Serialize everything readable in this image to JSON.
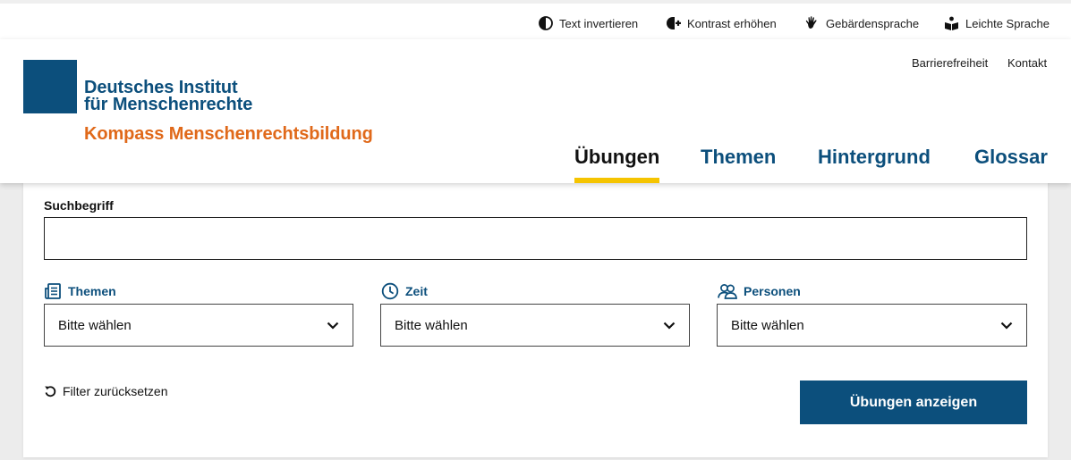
{
  "accessibility_bar": {
    "invert_text": "Text invertieren",
    "contrast": "Kontrast erhöhen",
    "sign_language": "Gebärdensprache",
    "easy_language": "Leichte Sprache"
  },
  "header": {
    "org_line1": "Deutsches Institut",
    "org_line2": "für Menschenrechte",
    "subtitle": "Kompass Menschenrechtsbildung",
    "meta_links": [
      "Barrierefreiheit",
      "Kontakt"
    ],
    "nav": [
      {
        "label": "Übungen",
        "active": true
      },
      {
        "label": "Themen",
        "active": false
      },
      {
        "label": "Hintergrund",
        "active": false
      },
      {
        "label": "Glossar",
        "active": false
      }
    ]
  },
  "search": {
    "label": "Suchbegriff",
    "value": "",
    "placeholder": ""
  },
  "filters": [
    {
      "label": "Themen",
      "icon": "document-list-icon",
      "selected": "Bitte wählen"
    },
    {
      "label": "Zeit",
      "icon": "clock-icon",
      "selected": "Bitte wählen"
    },
    {
      "label": "Personen",
      "icon": "people-icon",
      "selected": "Bitte wählen"
    }
  ],
  "actions": {
    "reset": "Filter zurücksetzen",
    "submit": "Übungen anzeigen"
  },
  "colors": {
    "brand_blue": "#0c4f7c",
    "brand_orange": "#e0691a",
    "active_underline": "#f5c400"
  }
}
